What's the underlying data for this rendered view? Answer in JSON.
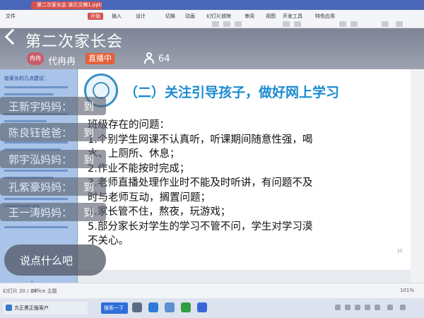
{
  "app": {
    "file_tab": "第二次家长会 演示文稿1.pptx",
    "ribbon_menus": [
      "文件",
      "开始",
      "插入",
      "设计",
      "切换",
      "动画",
      "幻灯片放映",
      "审阅",
      "视图",
      "开发工具",
      "特色应用"
    ],
    "active_menu": "开始"
  },
  "stream": {
    "title": "第二次家长会",
    "avatar_text": "冉冉",
    "host": "代冉冉",
    "live_badge": "直播中",
    "viewer_count": "64"
  },
  "thumbnail_hint": "给家长的几点建议：",
  "slide": {
    "title": "（二）关注引导孩子，做好网上学习",
    "lines": [
      "班级存在的问题：",
      "1.个别学生网课不认真听，听课期间随意性强，喝",
      "水、上厕所、休息；",
      "2.作业不能按时完成；",
      "3.老师直播处理作业时不能及时听讲，有问题不及",
      "时与老师互动，搁置问题；",
      "4.家长管不住，熬夜，玩游戏；",
      "5.部分家长对学生的学习不管不问，学生对学习漠",
      "不关心。"
    ],
    "page_mark": "25"
  },
  "chat": {
    "messages": [
      {
        "name": "王新宇妈妈：",
        "text": "到"
      },
      {
        "name": "陈良钰爸爸：",
        "text": "到"
      },
      {
        "name": "郭宇泓妈妈：",
        "text": "到"
      },
      {
        "name": "孔紫豪妈妈：",
        "text": "到"
      },
      {
        "name": "王一涛妈妈：",
        "text": "到"
      }
    ],
    "input_placeholder": "说点什么吧"
  },
  "statusbar": {
    "page": "幻灯片 20 / 24",
    "theme": "Office 主题",
    "zoom": "101%"
  },
  "taskbar": {
    "task_label": "方正黑正版客户",
    "search_label": "搜索一下"
  },
  "colors": {
    "slide_title": "#1a8bd0",
    "live_badge": "#e4603a",
    "thumb_panel": "#a9c4e8",
    "title_bar": "#4a66b8"
  }
}
